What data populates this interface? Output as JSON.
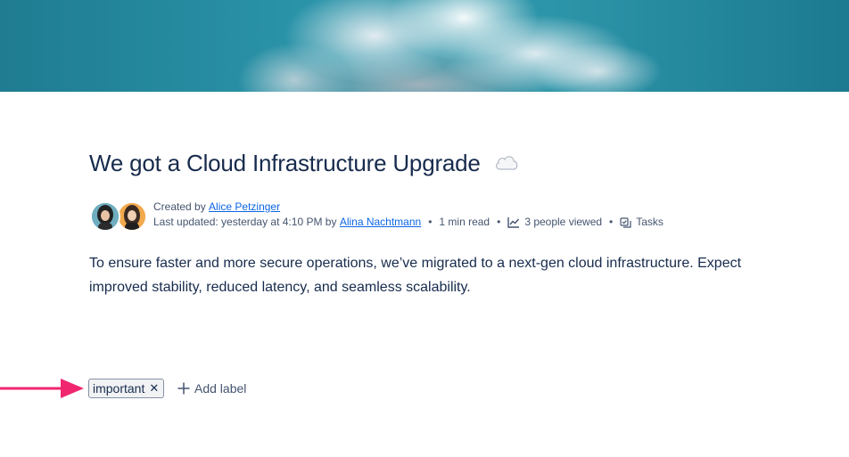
{
  "page": {
    "title": "We got a Cloud Infrastructure Upgrade",
    "title_emoji": "cloud-emoji"
  },
  "byline": {
    "created_prefix": "Created by ",
    "created_by": "Alice Petzinger",
    "updated_prefix": "Last updated: yesterday at 4:10 PM by ",
    "updated_by": "Alina Nachtmann",
    "separator": "•",
    "read_time": "1 min read",
    "views": "3 people viewed",
    "tasks": "Tasks"
  },
  "content": {
    "paragraph": "To ensure faster and more secure operations, we’ve migrated to a next-gen cloud infrastructure. Expect improved stability, reduced latency, and seamless scalability."
  },
  "labels": {
    "items": [
      "important"
    ],
    "remove_glyph": "✕",
    "add_label": "Add label"
  },
  "colors": {
    "link": "#0c66e4",
    "annotation_arrow": "#f0266f",
    "banner_sky": "#2a93a8"
  }
}
